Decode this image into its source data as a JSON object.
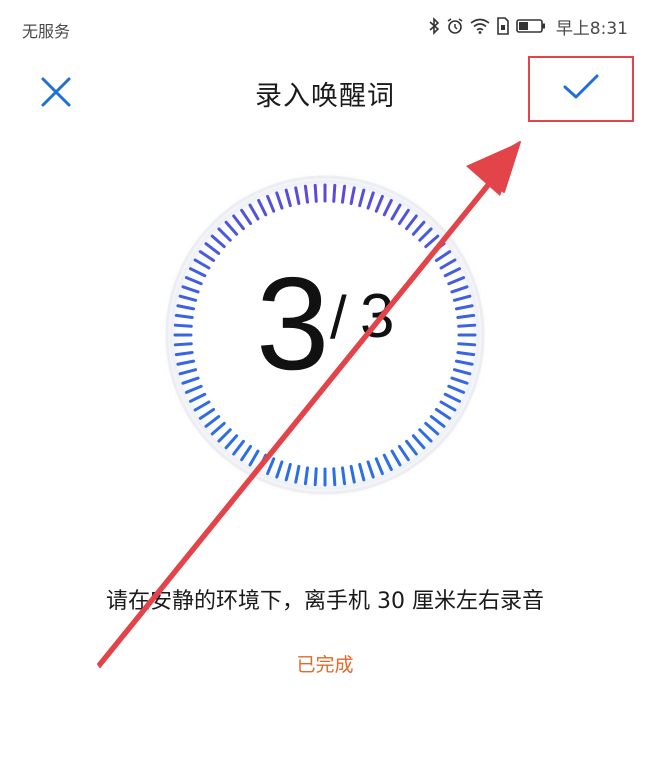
{
  "status_bar": {
    "carrier": "无服务",
    "time": "早上8:31",
    "icons": [
      "bluetooth-icon",
      "alarm-icon",
      "wifi-icon",
      "sim-icon",
      "battery-icon"
    ]
  },
  "header": {
    "title": "录入唤醒词",
    "close_icon": "close-icon",
    "confirm_icon": "check-icon"
  },
  "progress": {
    "current": "3",
    "separator": "/",
    "total": "3"
  },
  "instruction": "请在安静的环境下，离手机 30 厘米左右录音",
  "status_text": "已完成",
  "colors": {
    "accent": "#1e6fd9",
    "dial_start": "#2b6fe6",
    "dial_end": "#6a3fd6",
    "status_done": "#e06a2a",
    "annotation_red": "#e2444a"
  }
}
